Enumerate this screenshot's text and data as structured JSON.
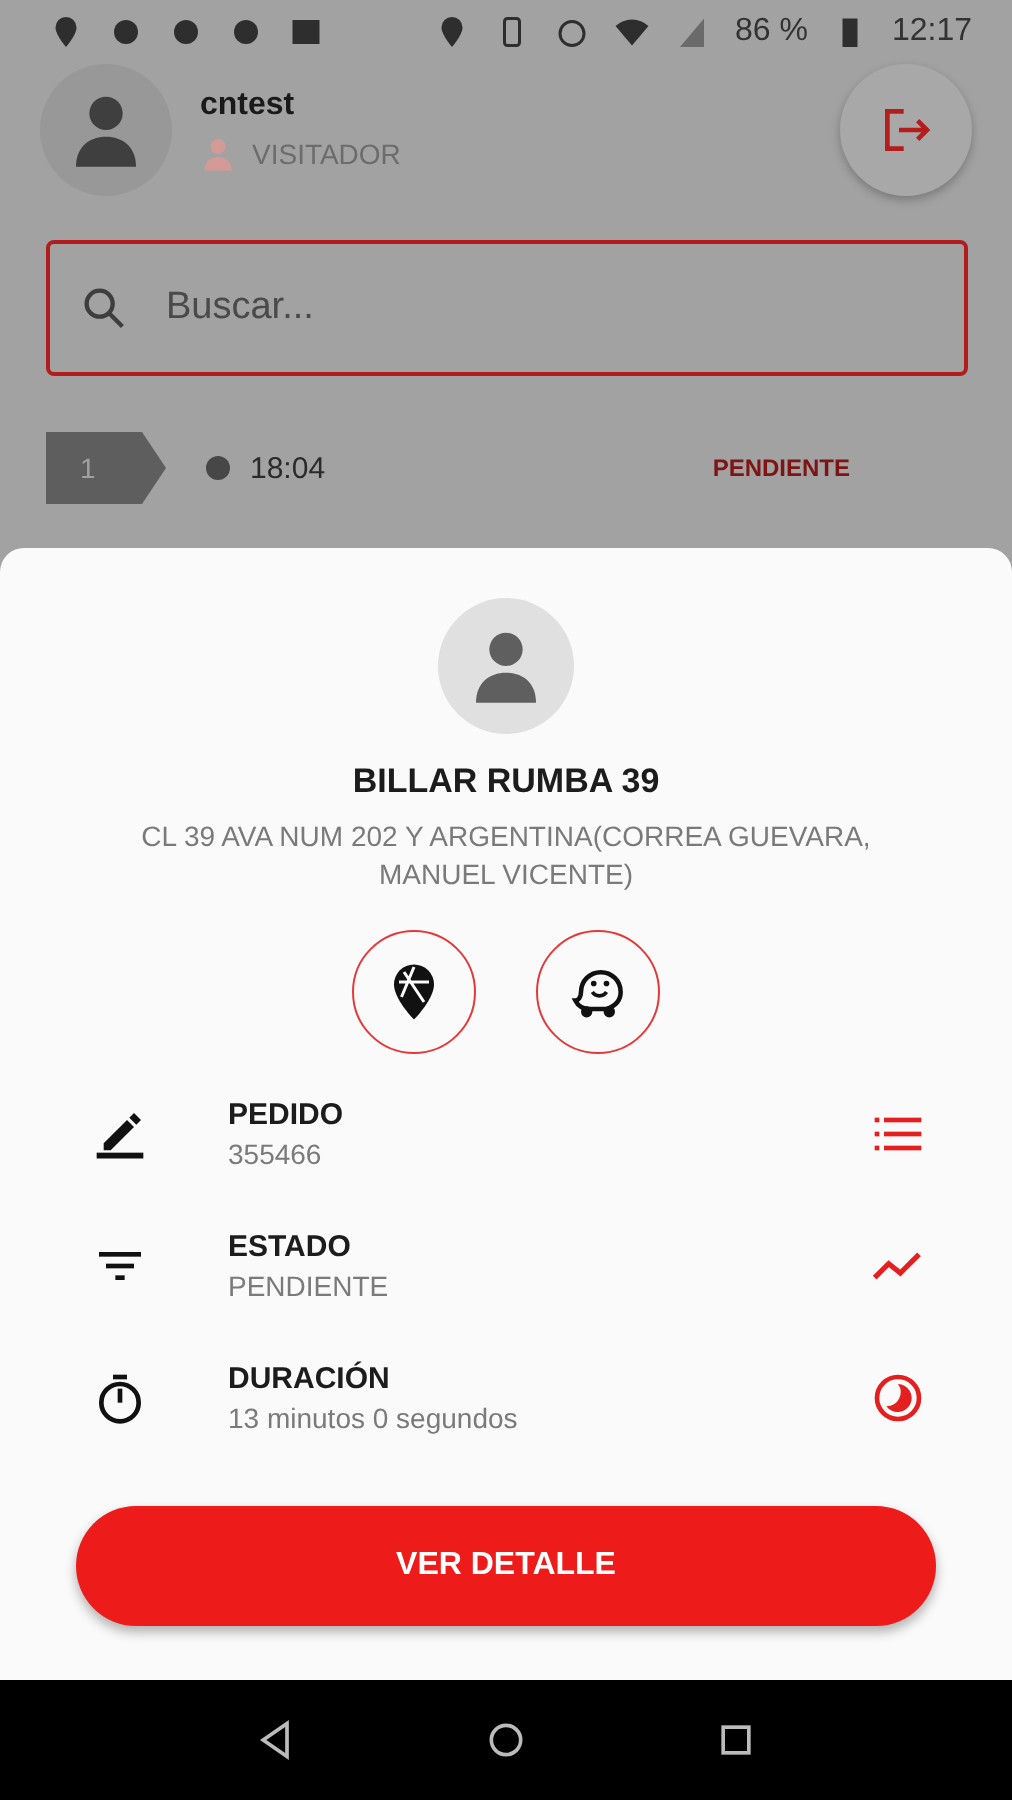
{
  "status_bar": {
    "battery": "86 %",
    "time": "12:17"
  },
  "user": {
    "name": "cntest",
    "role": "VISITADOR"
  },
  "search": {
    "placeholder": "Buscar..."
  },
  "list": [
    {
      "number": "1",
      "time": "18:04",
      "status": "PENDIENTE"
    }
  ],
  "sheet": {
    "title": "BILLAR RUMBA 39",
    "address": "CL 39 AVA NUM 202 Y ARGENTINA(CORREA GUEVARA, MANUEL VICENTE)",
    "details": [
      {
        "kind": "order",
        "label": "PEDIDO",
        "value": "355466"
      },
      {
        "kind": "status",
        "label": "ESTADO",
        "value": "PENDIENTE"
      },
      {
        "kind": "duration",
        "label": "DURACIÓN",
        "value": "13 minutos 0 segundos"
      }
    ],
    "button": "VER DETALLE"
  }
}
